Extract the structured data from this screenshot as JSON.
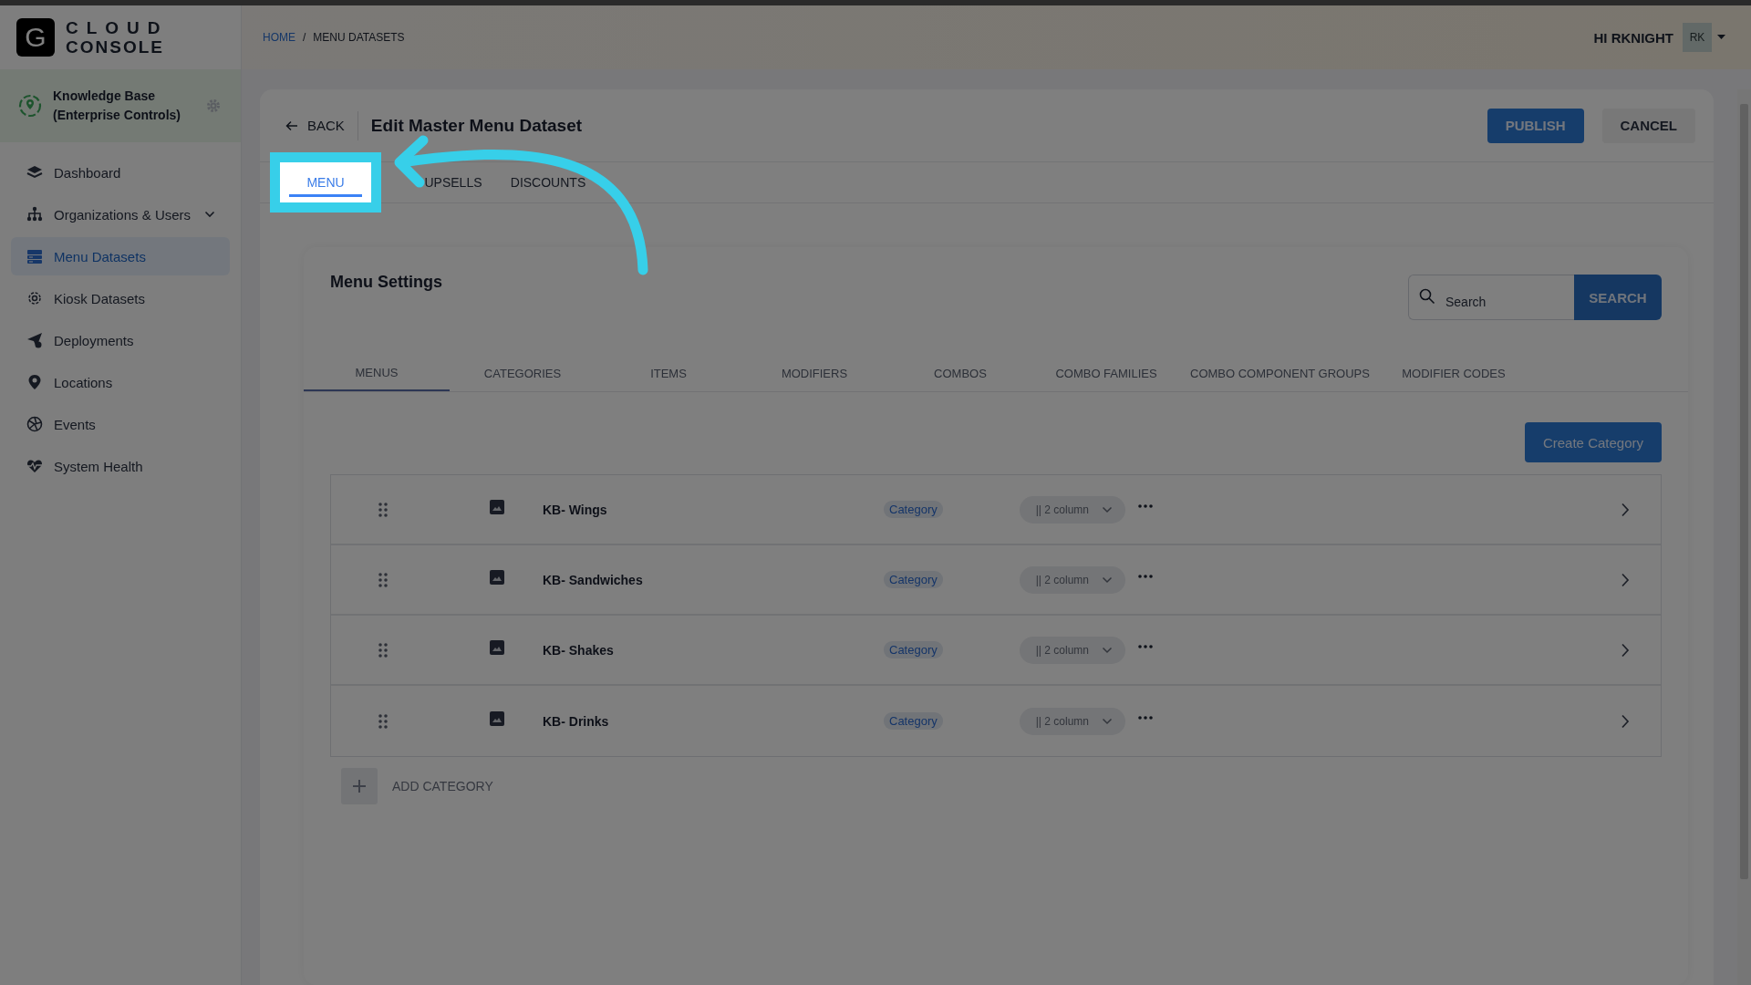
{
  "logo": {
    "letter": "G",
    "line_1": "CLOUD",
    "line_2": "CONSOLE"
  },
  "workspace": {
    "name": "Knowledge Base\n(Enterprise Controls)"
  },
  "sidebar": {
    "items": [
      {
        "label": "Dashboard",
        "selected": false,
        "expandable": false
      },
      {
        "label": "Organizations & Users",
        "selected": false,
        "expandable": true
      },
      {
        "label": "Menu Datasets",
        "selected": true,
        "expandable": false
      },
      {
        "label": "Kiosk Datasets",
        "selected": false,
        "expandable": false
      },
      {
        "label": "Deployments",
        "selected": false,
        "expandable": false
      },
      {
        "label": "Locations",
        "selected": false,
        "expandable": false
      },
      {
        "label": "Events",
        "selected": false,
        "expandable": false
      },
      {
        "label": "System Health",
        "selected": false,
        "expandable": false
      }
    ]
  },
  "breadcrumb": [
    {
      "label": "HOME",
      "link": true
    },
    {
      "label": "/",
      "link": false
    },
    {
      "label": "MENU DATASETS",
      "link": false
    }
  ],
  "user": {
    "greeting": "HI RKNIGHT",
    "initials": "RK"
  },
  "page": {
    "back": "BACK",
    "title": "Edit Master Menu Dataset",
    "buttons": [
      {
        "label": "PUBLISH",
        "kind": "primary"
      },
      {
        "label": "CANCEL",
        "kind": "secondary"
      }
    ]
  },
  "tabs": [
    {
      "label": "MENU",
      "selected": true,
      "spotlighted": true
    },
    {
      "label": "UPSELLS",
      "selected": false,
      "spotlighted": false
    },
    {
      "label": "DISCOUNTS",
      "selected": false,
      "spotlighted": false
    }
  ],
  "settings": {
    "title": "Menu Settings",
    "search": {
      "placeholder": "Search",
      "button": "SEARCH"
    },
    "tabs": [
      {
        "label": "MENUS",
        "selected": true
      },
      {
        "label": "CATEGORIES",
        "selected": false
      },
      {
        "label": "ITEMS",
        "selected": false
      },
      {
        "label": "MODIFIERS",
        "selected": false
      },
      {
        "label": "COMBOS",
        "selected": false
      },
      {
        "label": "COMBO FAMILIES",
        "selected": false
      },
      {
        "label": "COMBO COMPONENT GROUPS",
        "selected": false
      },
      {
        "label": "MODIFIER CODES",
        "selected": false
      }
    ],
    "create_button": "Create Category",
    "rows": [
      {
        "name": "KB- Wings",
        "tag": "Category",
        "layout": "|| 2 column"
      },
      {
        "name": "KB- Sandwiches",
        "tag": "Category",
        "layout": "|| 2 column"
      },
      {
        "name": "KB- Shakes",
        "tag": "Category",
        "layout": "|| 2 column"
      },
      {
        "name": "KB- Drinks",
        "tag": "Category",
        "layout": "|| 2 column"
      }
    ],
    "add_button": "ADD CATEGORY"
  }
}
